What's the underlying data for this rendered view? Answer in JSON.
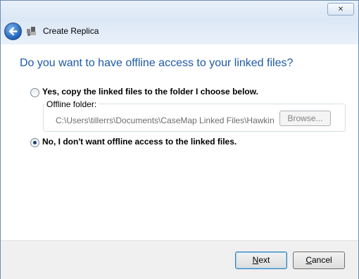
{
  "window": {
    "close_glyph": "✕"
  },
  "header": {
    "title": "Create Replica",
    "back_icon": "back-arrow-icon",
    "app_icon": "replica-icon"
  },
  "content": {
    "question": "Do you want to have offline access to your linked files?",
    "options": [
      {
        "label": "Yes, copy the linked files to the folder I choose below.",
        "checked": false
      },
      {
        "label": "No, I don't want offline access to the linked files.",
        "checked": true
      }
    ],
    "offline_folder": {
      "legend": "Offline folder:",
      "path": "C:\\Users\\tillerrs\\Documents\\CaseMap Linked Files\\Hawkins",
      "browse_label": "Browse..."
    }
  },
  "footer": {
    "next_label": "Next",
    "next_accel": "N",
    "next_rest": "ext",
    "cancel_label": "Cancel",
    "cancel_accel": "C",
    "cancel_rest": "ancel"
  },
  "colors": {
    "question_text": "#1e5aa8",
    "header_bg": "#dce8f6",
    "footer_bg": "#f0f0f0"
  }
}
